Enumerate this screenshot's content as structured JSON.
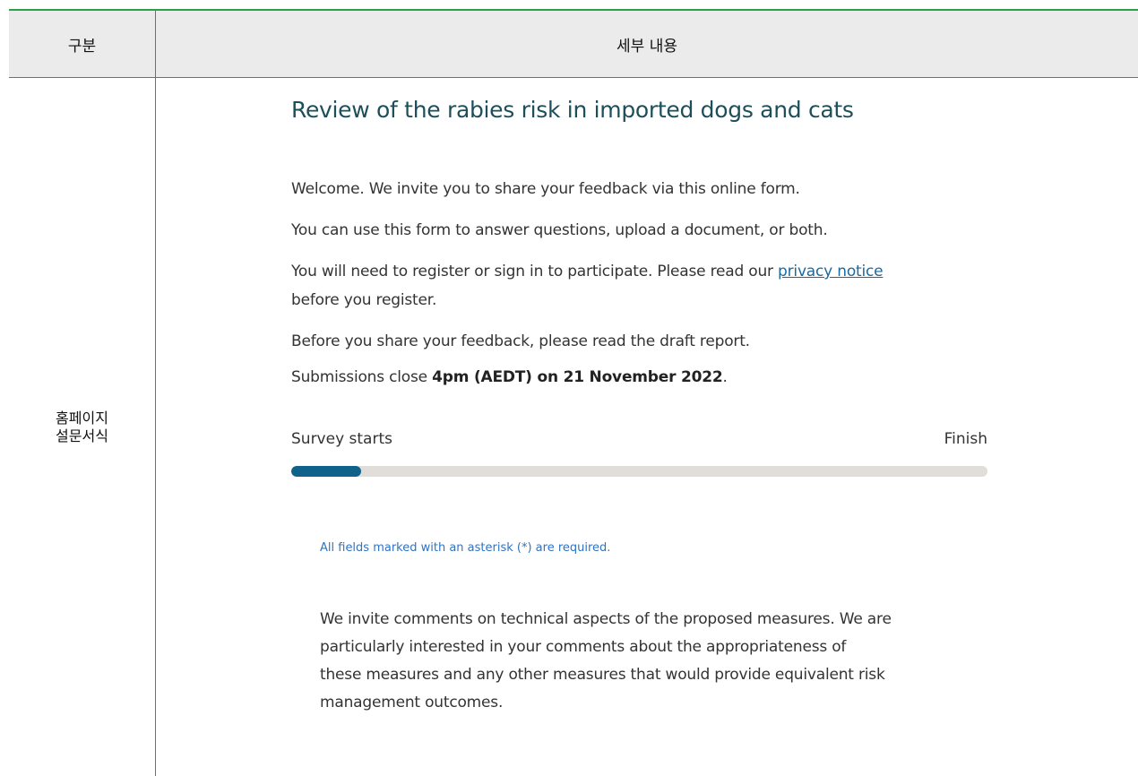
{
  "table": {
    "header_col1": "구분",
    "header_col2": "세부 내용",
    "row_label_line1": "홈페이지",
    "row_label_line2": "설문서식"
  },
  "form": {
    "title": "Review of the rabies risk in imported dogs and cats",
    "welcome": "Welcome. We invite you to share your feedback via this online form.",
    "use_form": "You can use this form to answer questions, upload a document, or both.",
    "register_prefix": "You will need to register or sign in to participate. Please read our ",
    "privacy_link": "privacy notice",
    "register_suffix": "before you register.",
    "draft_report": "Before you share your feedback, please read the draft report.",
    "submissions_prefix": "Submissions close ",
    "submissions_deadline": "4pm (AEDT) on 21 November 2022",
    "submissions_suffix": ".",
    "required_note": "All fields marked with an asterisk (*) are required.",
    "intro_lines": [
      "We invite comments on technical aspects of the proposed measures. We are",
      "particularly interested in your comments about the appropriateness of",
      "these measures and any other measures that would provide equivalent risk",
      "management outcomes."
    ]
  },
  "progress": {
    "start_label": "Survey starts",
    "end_label": "Finish",
    "percent": 10,
    "fill_color": "#11628a",
    "track_color": "#e1ddd9"
  },
  "colors": {
    "title": "#1d4f5b",
    "link": "#1b6a9e",
    "required_note": "#2f74c4",
    "table_top_border": "#2e9e4a",
    "header_bg": "#ebebeb"
  }
}
